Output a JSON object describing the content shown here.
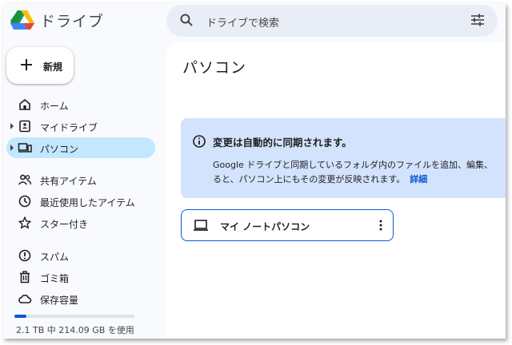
{
  "app": {
    "title": "ドライブ"
  },
  "search": {
    "placeholder": "ドライブで検索"
  },
  "sidebar": {
    "new_label": "新規",
    "items": [
      {
        "label": "ホーム",
        "icon": "home-icon"
      },
      {
        "label": "マイドライブ",
        "icon": "my-drive-icon"
      },
      {
        "label": "パソコン",
        "icon": "computers-icon",
        "active": true
      },
      {
        "label": "共有アイテム",
        "icon": "shared-icon"
      },
      {
        "label": "最近使用したアイテム",
        "icon": "clock-icon"
      },
      {
        "label": "スター付き",
        "icon": "star-icon"
      },
      {
        "label": "スパム",
        "icon": "spam-icon"
      },
      {
        "label": "ゴミ箱",
        "icon": "trash-icon"
      },
      {
        "label": "保存容量",
        "icon": "cloud-icon"
      }
    ],
    "storage": {
      "text": "2.1 TB 中 214.09 GB を使用",
      "used_fraction": 0.1
    }
  },
  "main": {
    "title": "パソコン",
    "banner": {
      "heading": "変更は自動的に同期されます。",
      "line1": "Google ドライブと同期しているフォルダ内のファイルを追加、編集、",
      "line2": "ると、パソコン上にもその変更が反映されます。",
      "details_link": "詳細"
    },
    "device": {
      "label": "マイ ノートパソコン"
    }
  },
  "colors": {
    "accent": "#0b57d0",
    "active_nav": "#c2e7ff",
    "banner": "#d3e3fd"
  }
}
